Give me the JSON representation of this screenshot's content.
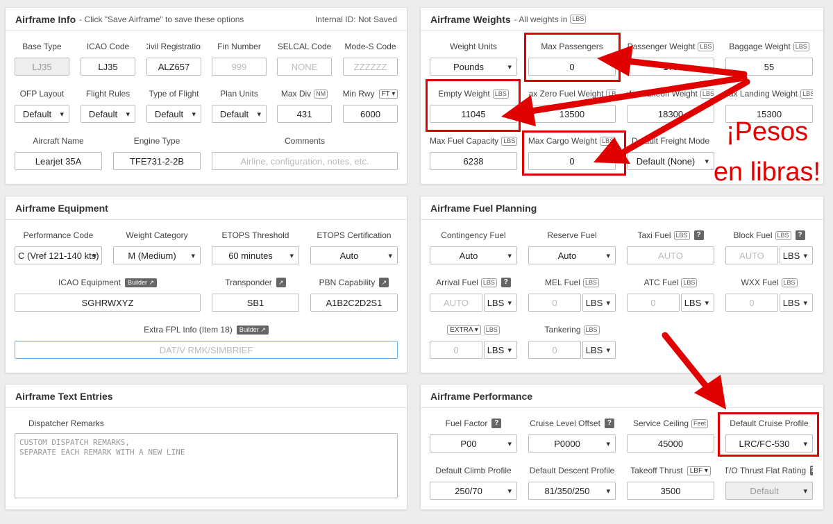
{
  "info": {
    "title": "Airframe Info",
    "subtitle": "- Click \"Save Airframe\" to save these options",
    "internal_id": "Internal ID: Not Saved",
    "base_type_label": "Base Type",
    "base_type": "LJ35",
    "icao_label": "ICAO Code",
    "icao": "LJ35",
    "reg_label": "Civil Registration",
    "reg": "ALZ657",
    "fin_label": "Fin Number",
    "fin_ph": "999",
    "selcal_label": "SELCAL Code",
    "selcal_ph": "NONE",
    "modes_label": "Mode-S Code",
    "modes_ph": "ZZZZZZ",
    "ofp_label": "OFP Layout",
    "ofp": "Default",
    "rules_label": "Flight Rules",
    "rules": "Default",
    "type_label": "Type of Flight",
    "type": "Default",
    "units_label": "Plan Units",
    "units": "Default",
    "maxdiv_label": "Max Div",
    "maxdiv_unit": "NM",
    "maxdiv": "431",
    "minrwy_label": "Min Rwy",
    "minrwy_unit": "FT",
    "minrwy": "6000",
    "acname_label": "Aircraft Name",
    "acname": "Learjet 35A",
    "engine_label": "Engine Type",
    "engine": "TFE731-2-2B",
    "comments_label": "Comments",
    "comments_ph": "Airline, configuration, notes, etc."
  },
  "weights": {
    "title": "Airframe Weights",
    "subtitle": "- All weights in",
    "unit": "LBS",
    "wunits_label": "Weight Units",
    "wunits": "Pounds",
    "maxpax_label": "Max Passengers",
    "maxpax": "0",
    "paxw_label": "Passenger Weight",
    "paxw": "175",
    "bagw_label": "Baggage Weight",
    "bagw": "55",
    "empty_label": "Empty Weight",
    "empty": "11045",
    "mzfw_label": "Max Zero Fuel Weight",
    "mzfw": "13500",
    "mtow_label": "Max Takeoff Weight",
    "mtow": "18300",
    "mlw_label": "Max Landing Weight",
    "mlw": "15300",
    "maxfuel_label": "Max Fuel Capacity",
    "maxfuel": "6238",
    "maxcargo_label": "Max Cargo Weight",
    "maxcargo": "0",
    "freight_label": "Default Freight Mode",
    "freight": "Default (None)"
  },
  "equipment": {
    "title": "Airframe Equipment",
    "perf_label": "Performance Code",
    "perf": "C (Vref 121-140 kts)",
    "wcat_label": "Weight Category",
    "wcat": "M (Medium)",
    "etops_label": "ETOPS Threshold",
    "etops": "60 minutes",
    "etopscert_label": "ETOPS Certification",
    "etopscert": "Auto",
    "icaoeq_label": "ICAO Equipment",
    "builder": "Builder",
    "icaoeq": "SGHRWXYZ",
    "xpdr_label": "Transponder",
    "xpdr": "SB1",
    "pbn_label": "PBN Capability",
    "pbn": "A1B2C2D2S1",
    "extra_label": "Extra FPL Info (Item 18)",
    "extra_ph": "DAT/V RMK/SIMBRIEF"
  },
  "fuel": {
    "title": "Airframe Fuel Planning",
    "contingency_label": "Contingency Fuel",
    "contingency": "Auto",
    "reserve_label": "Reserve Fuel",
    "reserve": "Auto",
    "taxi_label": "Taxi Fuel",
    "taxi_ph": "AUTO",
    "block_label": "Block Fuel",
    "block_ph": "AUTO",
    "block_unit": "LBS",
    "arrival_label": "Arrival Fuel",
    "arrival_ph": "AUTO",
    "arrival_unit": "LBS",
    "mel_label": "MEL Fuel",
    "mel_ph": "0",
    "mel_unit": "LBS",
    "atc_label": "ATC Fuel",
    "atc_ph": "0",
    "atc_unit": "LBS",
    "wxx_label": "WXX Fuel",
    "wxx_ph": "0",
    "wxx_unit": "LBS",
    "extra_sel": "EXTRA",
    "extra_ph": "0",
    "extra_unit": "LBS",
    "tank_label": "Tankering",
    "tank_ph": "0",
    "tank_unit": "LBS",
    "lbs": "LBS"
  },
  "text": {
    "title": "Airframe Text Entries",
    "remarks_label": "Dispatcher Remarks",
    "remarks_ph": "CUSTOM DISPATCH REMARKS,\nSEPARATE EACH REMARK WITH A NEW LINE"
  },
  "perf": {
    "title": "Airframe Performance",
    "ff_label": "Fuel Factor",
    "ff": "P00",
    "clo_label": "Cruise Level Offset",
    "clo": "P0000",
    "ceil_label": "Service Ceiling",
    "ceil_unit": "Feet",
    "ceil": "45000",
    "cruise_label": "Default Cruise Profile",
    "cruise": "LRC/FC-530",
    "climb_label": "Default Climb Profile",
    "climb": "250/70",
    "descent_label": "Default Descent Profile",
    "descent": "81/350/250",
    "thrust_label": "Takeoff Thrust",
    "thrust_unit": "LBF",
    "thrust": "3500",
    "flat_label": "T/O Thrust Flat Rating",
    "flat": "Default"
  },
  "annotation": {
    "line1": "¡Pesos",
    "line2": "en libras!",
    "color": "#e00000"
  },
  "q": "?"
}
